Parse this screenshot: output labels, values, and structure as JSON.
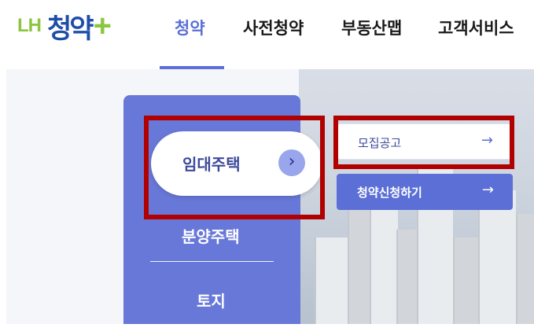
{
  "logo": {
    "lh": "LH",
    "main": "청약",
    "plus": "+"
  },
  "nav": {
    "items": [
      {
        "label": "청약",
        "active": true
      },
      {
        "label": "사전청약",
        "active": false
      },
      {
        "label": "부동산맵",
        "active": false
      },
      {
        "label": "고객서비스",
        "active": false
      }
    ]
  },
  "menu": {
    "selected": {
      "label": "임대주택",
      "arrow": "›"
    },
    "items": [
      "분양주택",
      "토지"
    ]
  },
  "submenu": {
    "notice": {
      "label": "모집공고",
      "arrow": "→"
    },
    "apply": {
      "label": "청약신청하기",
      "arrow": "→"
    }
  },
  "colors": {
    "accent": "#5b6fd6",
    "panel": "#6878d8",
    "logo_green": "#8cc63f",
    "logo_blue": "#1f4ea8",
    "highlight": "#b00000"
  }
}
